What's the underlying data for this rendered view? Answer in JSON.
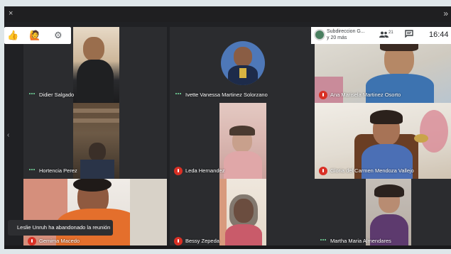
{
  "window": {
    "close_glyph": "×",
    "collapse_glyph": "»",
    "side_arrow": "‹"
  },
  "reactions": {
    "thumbs": "👍",
    "hand": "🙋",
    "settings": "⚙"
  },
  "meeting": {
    "group_name": "Subdireccion G...",
    "others": "y 20 más",
    "people_count": "21",
    "people_icon": "people-icon",
    "chat_icon": "chat-icon",
    "time": "16:44"
  },
  "participants": [
    {
      "name": "Didier Salgado",
      "state": "speaking"
    },
    {
      "name": "Ivette Vanessa Martinez Solorzano",
      "state": "speaking"
    },
    {
      "name": "Ana Marisela Martinez Osorto",
      "state": "muted"
    },
    {
      "name": "Hortencia Perez",
      "state": "speaking"
    },
    {
      "name": "Leda Hernandez",
      "state": "muted"
    },
    {
      "name": "Gloria del Carmen Mendoza Vallejo",
      "state": "muted"
    },
    {
      "name": "Gemima Macedo",
      "state": "muted"
    },
    {
      "name": "Bessy Zepeda",
      "state": "muted"
    },
    {
      "name": "Martha Maria Almendares",
      "state": "speaking"
    }
  ],
  "notification": "Leslie Unruh ha abandonado la reunión",
  "colors": {
    "mute_red": "#d93025",
    "talk_green": "#7ae7a5",
    "tile_bg": "#3c4043"
  }
}
